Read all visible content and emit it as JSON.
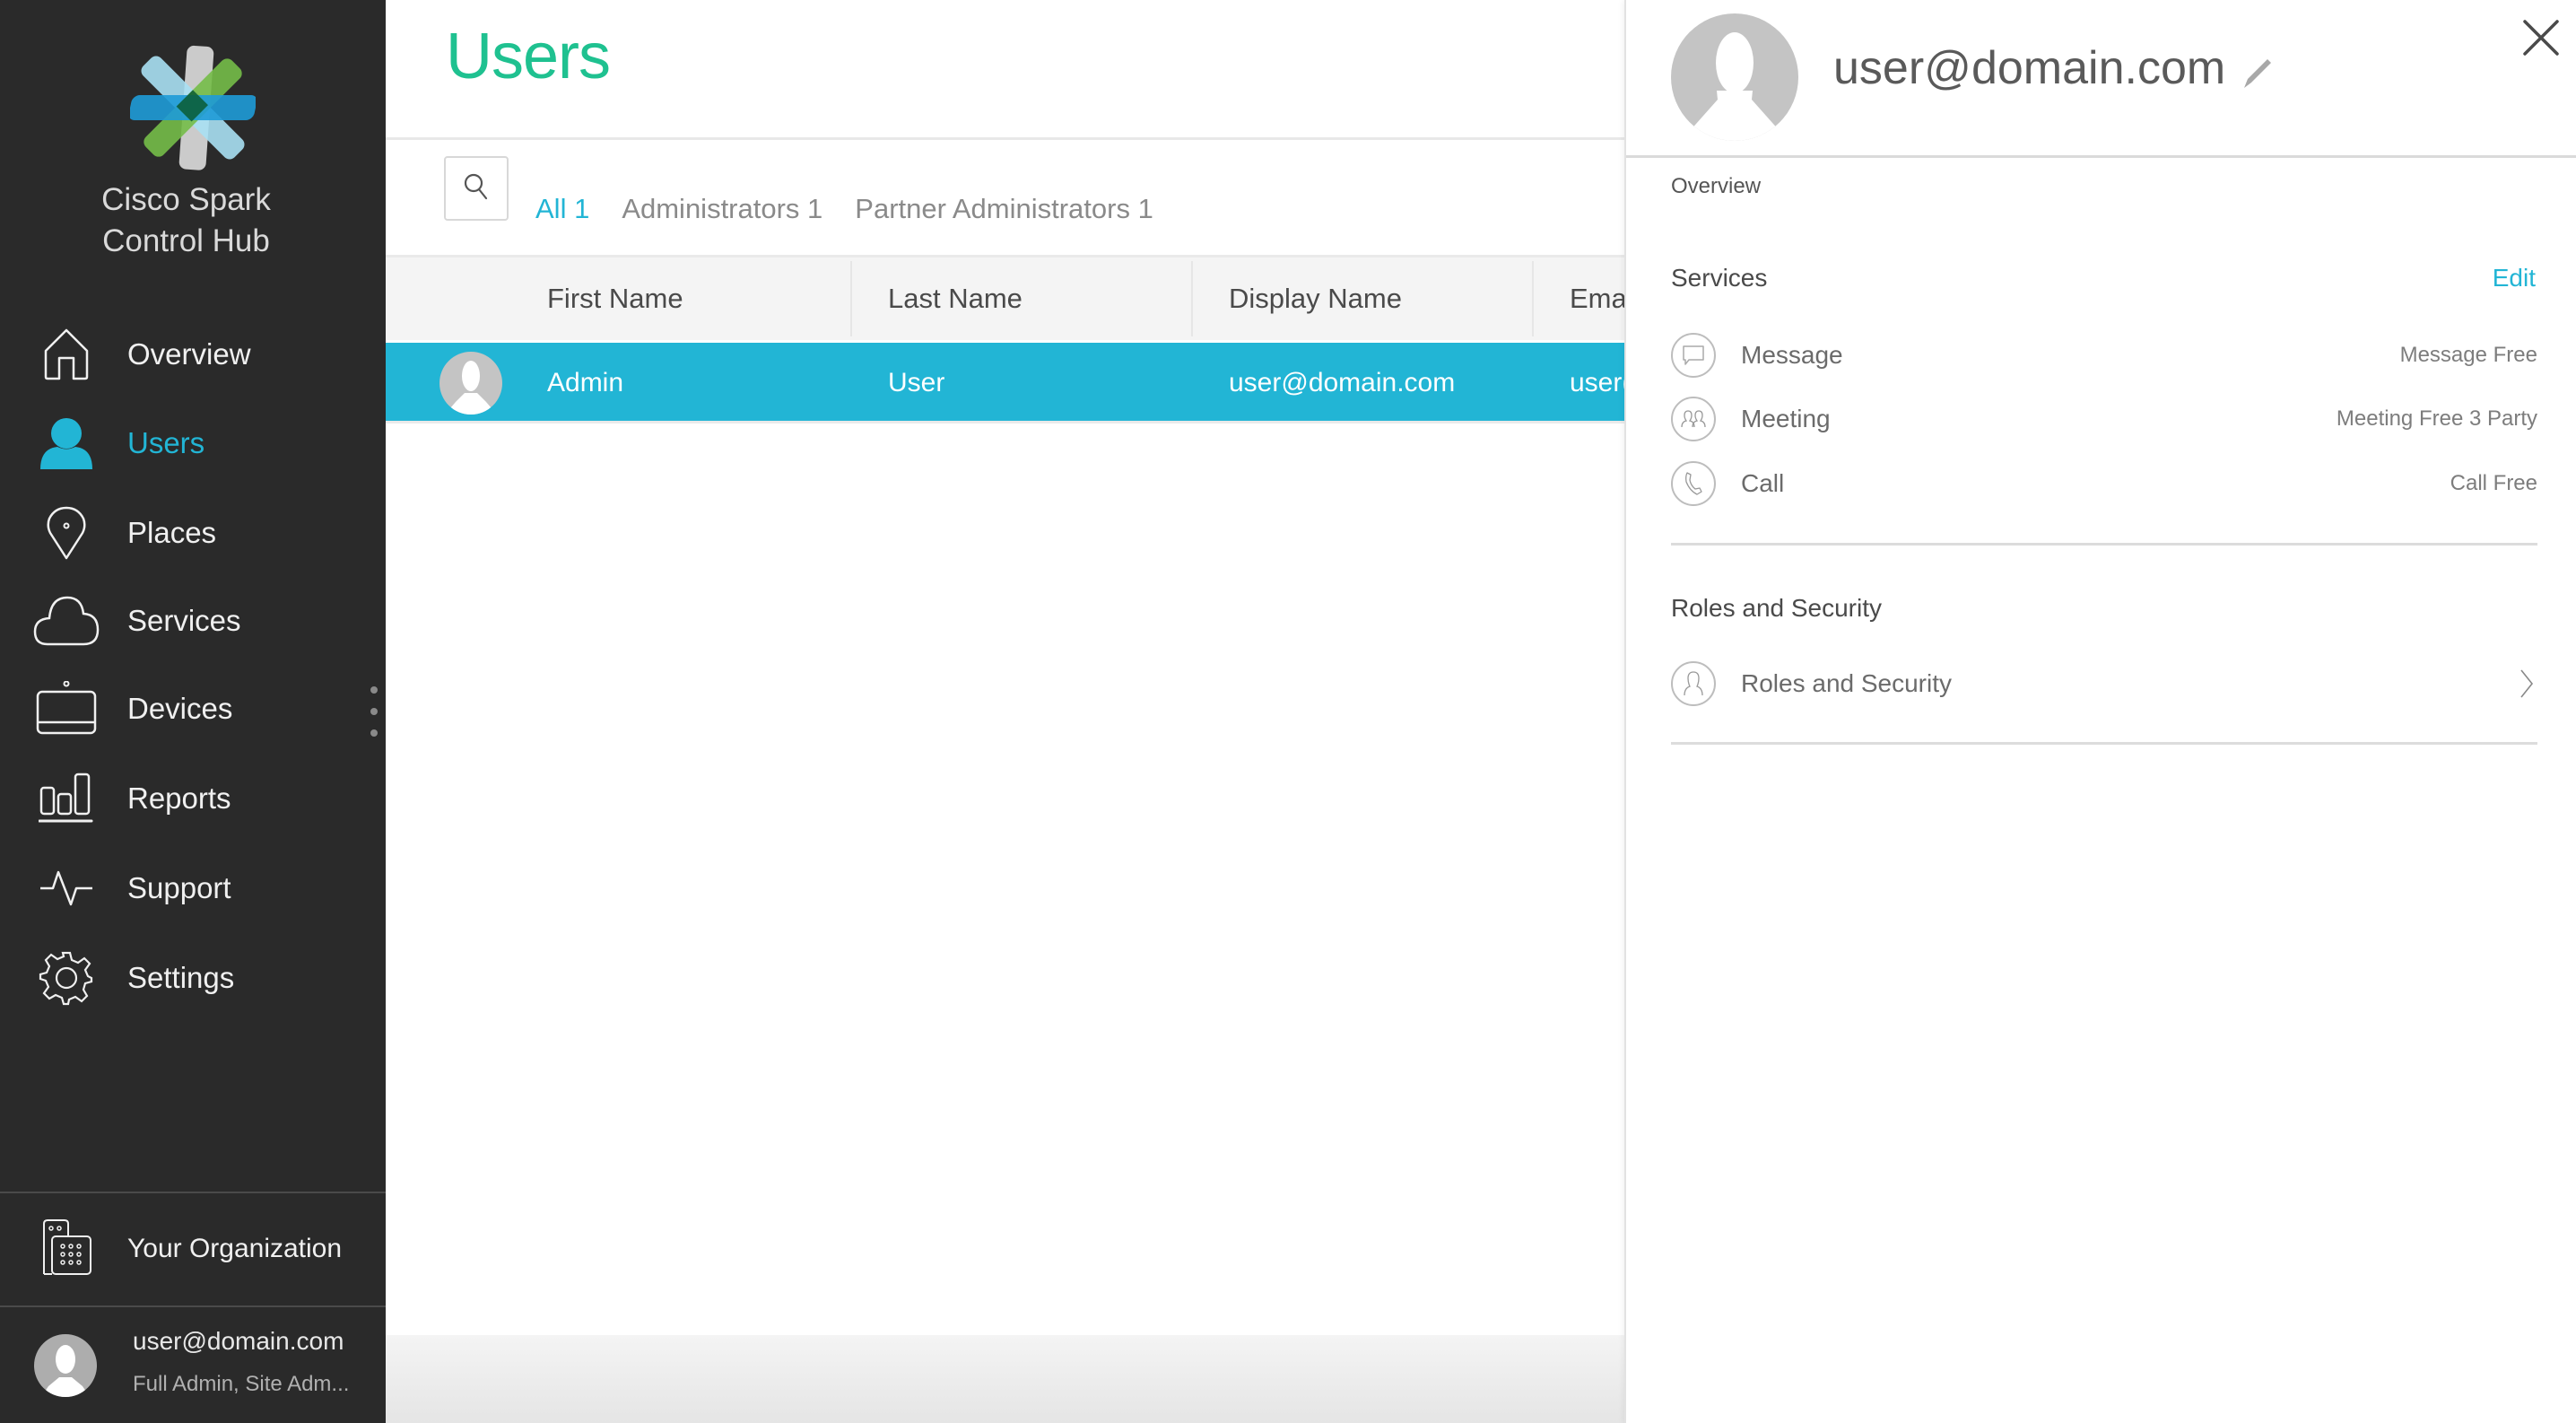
{
  "colors": {
    "sidebar_bg": "#2a2a2a",
    "accent": "#22b5d5",
    "title_green": "#1fc190",
    "selected_row": "#22b5d5"
  },
  "sidebar": {
    "brand_line1": "Cisco Spark",
    "brand_line2": "Control Hub",
    "items": [
      {
        "label": "Overview",
        "icon": "home-icon",
        "active": false
      },
      {
        "label": "Users",
        "icon": "user-icon",
        "active": true
      },
      {
        "label": "Places",
        "icon": "location-pin-icon",
        "active": false
      },
      {
        "label": "Services",
        "icon": "cloud-icon",
        "active": false
      },
      {
        "label": "Devices",
        "icon": "device-icon",
        "active": false
      },
      {
        "label": "Reports",
        "icon": "bar-chart-icon",
        "active": false
      },
      {
        "label": "Support",
        "icon": "pulse-icon",
        "active": false
      },
      {
        "label": "Settings",
        "icon": "gear-icon",
        "active": false
      }
    ],
    "organization_label": "Your Organization",
    "current_user": {
      "email": "user@domain.com",
      "roles": "Full Admin, Site Adm..."
    }
  },
  "main": {
    "title": "Users",
    "tabs": [
      {
        "label": "All 1",
        "active": true
      },
      {
        "label": "Administrators 1",
        "active": false
      },
      {
        "label": "Partner Administrators 1",
        "active": false
      }
    ],
    "table": {
      "columns": [
        "First Name",
        "Last Name",
        "Display Name",
        "Ema"
      ],
      "rows": [
        {
          "first_name": "Admin",
          "last_name": "User",
          "display_name": "user@domain.com",
          "email": "user(",
          "selected": true
        }
      ]
    }
  },
  "panel": {
    "title": "user@domain.com",
    "tab": "Overview",
    "services": {
      "title": "Services",
      "edit_label": "Edit",
      "items": [
        {
          "name": "Message",
          "value": "Message Free",
          "icon": "message-icon"
        },
        {
          "name": "Meeting",
          "value": "Meeting Free 3 Party",
          "icon": "meeting-icon"
        },
        {
          "name": "Call",
          "value": "Call Free",
          "icon": "phone-icon"
        }
      ]
    },
    "roles": {
      "title": "Roles and Security",
      "item_label": "Roles and Security",
      "icon": "person-icon"
    }
  }
}
